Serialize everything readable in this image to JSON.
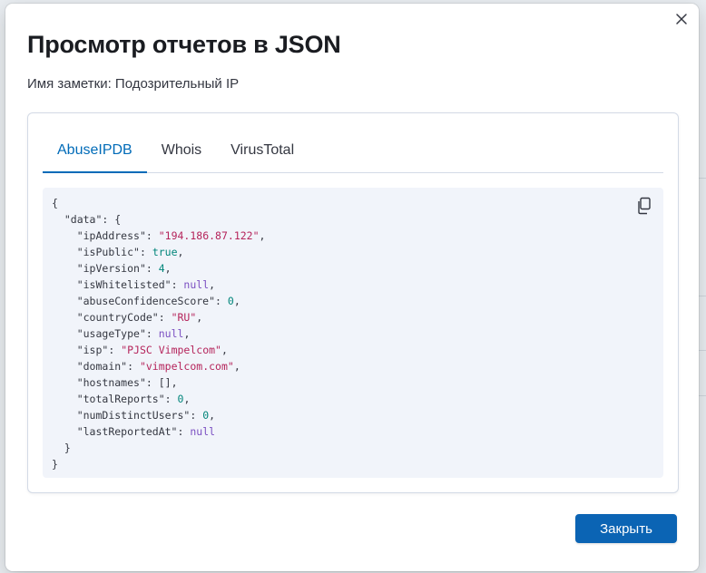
{
  "modal": {
    "title": "Просмотр отчетов в JSON",
    "note_label": "Имя заметки: Подозрительный IP",
    "close_button_label": "Закрыть"
  },
  "tabs": [
    {
      "label": "AbuseIPDB",
      "active": true
    },
    {
      "label": "Whois",
      "active": false
    },
    {
      "label": "VirusTotal",
      "active": false
    }
  ],
  "json_report": {
    "root_key": "data",
    "fields": [
      {
        "key": "ipAddress",
        "value": "\"194.186.87.122\"",
        "type": "string"
      },
      {
        "key": "isPublic",
        "value": "true",
        "type": "bool"
      },
      {
        "key": "ipVersion",
        "value": "4",
        "type": "number"
      },
      {
        "key": "isWhitelisted",
        "value": "null",
        "type": "null"
      },
      {
        "key": "abuseConfidenceScore",
        "value": "0",
        "type": "number"
      },
      {
        "key": "countryCode",
        "value": "\"RU\"",
        "type": "string"
      },
      {
        "key": "usageType",
        "value": "null",
        "type": "null"
      },
      {
        "key": "isp",
        "value": "\"PJSC Vimpelcom\"",
        "type": "string"
      },
      {
        "key": "domain",
        "value": "\"vimpelcom.com\"",
        "type": "string"
      },
      {
        "key": "hostnames",
        "value": "[]",
        "type": "array"
      },
      {
        "key": "totalReports",
        "value": "0",
        "type": "number"
      },
      {
        "key": "numDistinctUsers",
        "value": "0",
        "type": "number"
      },
      {
        "key": "lastReportedAt",
        "value": "null",
        "type": "null"
      }
    ]
  },
  "icons": {
    "close": "close-icon",
    "copy": "copy-icon"
  },
  "colors": {
    "accent": "#006bb8",
    "primary_button": "#0b64b4",
    "code_background": "#f1f4fa",
    "string_value": "#b5245b",
    "number_value": "#00857a",
    "null_value": "#7b4fc2"
  }
}
